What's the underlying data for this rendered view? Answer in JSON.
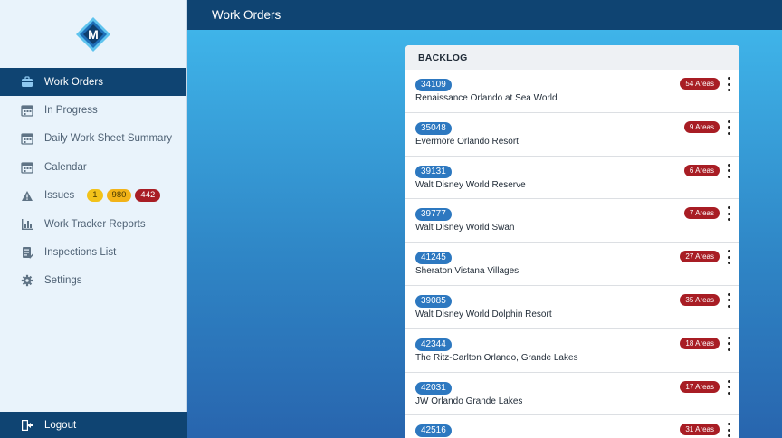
{
  "app": {
    "logo_letter": "M"
  },
  "header": {
    "title": "Work Orders"
  },
  "sidebar": {
    "items": [
      {
        "label": "Work Orders",
        "icon": "briefcase-icon",
        "active": true
      },
      {
        "label": "In Progress",
        "icon": "calendar-icon"
      },
      {
        "label": "Daily Work Sheet Summary",
        "icon": "calendar-icon"
      },
      {
        "label": "Calendar",
        "icon": "calendar-icon"
      },
      {
        "label": "Issues",
        "icon": "warning-icon",
        "badges": [
          "1",
          "980",
          "442"
        ]
      },
      {
        "label": "Work Tracker Reports",
        "icon": "bar-chart-icon"
      },
      {
        "label": "Inspections List",
        "icon": "checklist-icon"
      },
      {
        "label": "Settings",
        "icon": "gear-icon"
      }
    ],
    "logout_label": "Logout"
  },
  "backlog": {
    "title": "BACKLOG",
    "rows": [
      {
        "id": "34109",
        "name": "Renaissance Orlando at Sea World",
        "areas": "54 Areas"
      },
      {
        "id": "35048",
        "name": "Evermore Orlando Resort",
        "areas": "9 Areas"
      },
      {
        "id": "39131",
        "name": "Walt Disney World Reserve",
        "areas": "6 Areas"
      },
      {
        "id": "39777",
        "name": "Walt Disney World Swan",
        "areas": "7 Areas"
      },
      {
        "id": "41245",
        "name": "Sheraton Vistana Villages",
        "areas": "27 Areas"
      },
      {
        "id": "39085",
        "name": "Walt Disney World Dolphin Resort",
        "areas": "35 Areas"
      },
      {
        "id": "42344",
        "name": "The Ritz-Carlton Orlando, Grande Lakes",
        "areas": "18 Areas"
      },
      {
        "id": "42031",
        "name": "JW Orlando Grande Lakes",
        "areas": "17 Areas"
      },
      {
        "id": "42516",
        "name": "",
        "areas": "31 Areas"
      }
    ]
  },
  "colors": {
    "nav_active": "#0f4472",
    "id_badge": "#2d78c0",
    "areas_badge": "#a81d24"
  }
}
